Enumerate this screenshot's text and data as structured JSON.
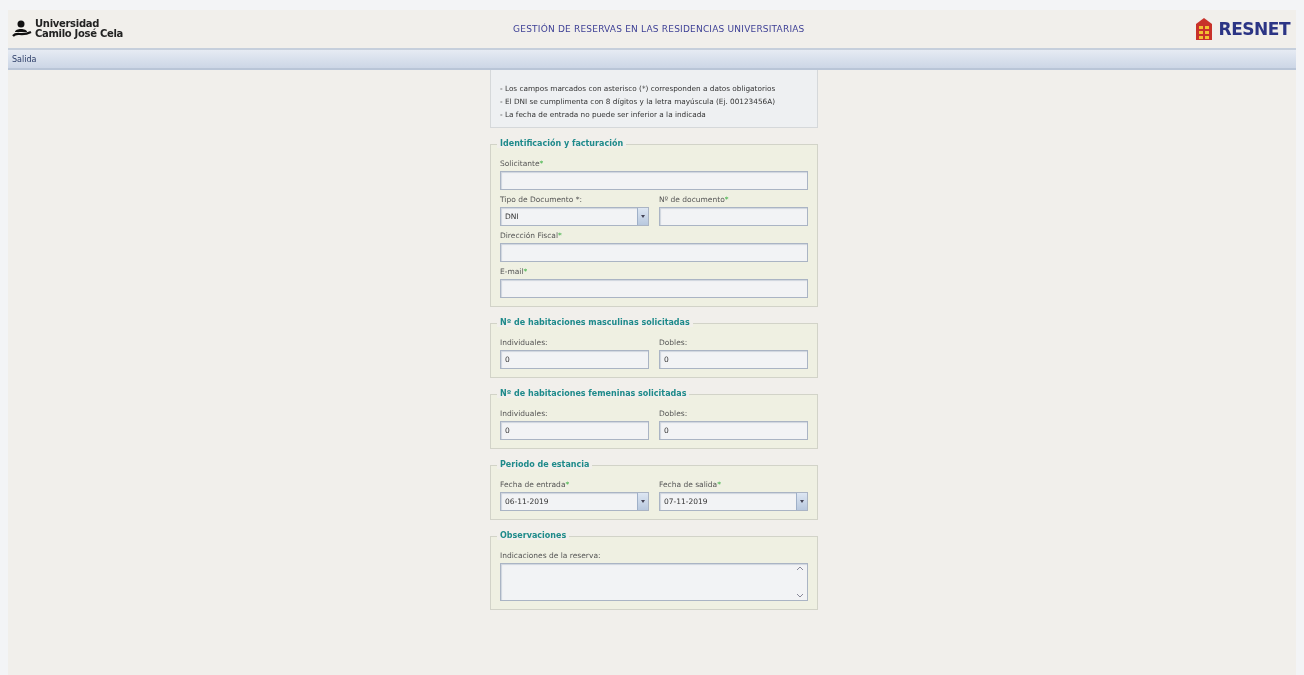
{
  "header": {
    "university": [
      "Universidad",
      "Camilo José Cela"
    ],
    "title": "GESTIÓN DE RESERVAS EN LAS RESIDENCIAS UNIVERSITARIAS",
    "brand": "RESNET"
  },
  "menu": [
    "Salida"
  ],
  "notes": [
    "- Los campos marcados con asterisco (*) corresponden a datos obligatorios",
    "- El DNI se cumplimenta con 8 dígitos y la letra mayúscula (Ej. 00123456A)",
    "- La fecha de entrada no puede ser inferior a la indicada"
  ],
  "sections": [
    {
      "legend": "Identificación y facturación",
      "rows": [
        [
          {
            "label": "Solicitante",
            "mark": "*",
            "kind": "text"
          }
        ],
        [
          {
            "label": "Tipo de Documento *:",
            "kind": "select",
            "value": "DNI"
          },
          {
            "label": "Nº de documento",
            "mark": "*",
            "kind": "text"
          }
        ],
        [
          {
            "label": "Dirección Fiscal",
            "mark": "*",
            "kind": "text"
          }
        ],
        [
          {
            "label": "E-mail",
            "mark": "*",
            "kind": "text"
          }
        ]
      ]
    },
    {
      "legend": "Nº de habitaciones masculinas solicitadas",
      "rows": [
        [
          {
            "label": "Individuales:",
            "kind": "text",
            "value": "0"
          },
          {
            "label": "Dobles:",
            "kind": "text",
            "value": "0"
          }
        ]
      ]
    },
    {
      "legend": "Nº de habitaciones femeninas solicitadas",
      "rows": [
        [
          {
            "label": "Individuales:",
            "kind": "text",
            "value": "0"
          },
          {
            "label": "Dobles:",
            "kind": "text",
            "value": "0"
          }
        ]
      ]
    },
    {
      "legend": "Periodo de estancia",
      "rows": [
        [
          {
            "label": "Fecha de entrada",
            "mark": "*",
            "kind": "select",
            "value": "06-11-2019"
          },
          {
            "label": "Fecha de salida",
            "mark": "*",
            "kind": "select",
            "value": "07-11-2019"
          }
        ]
      ]
    },
    {
      "legend": "Observaciones",
      "rows": [
        [
          {
            "label": "Indicaciones de la reserva:",
            "kind": "textarea"
          }
        ]
      ]
    }
  ]
}
